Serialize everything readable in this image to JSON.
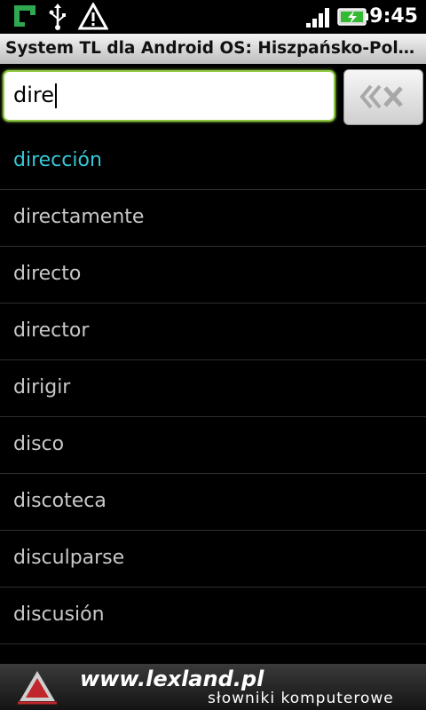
{
  "status_bar": {
    "time": "9:45",
    "icons": [
      "app-notification-icon",
      "usb-icon",
      "warning-icon",
      "signal-icon",
      "battery-charging-icon"
    ]
  },
  "title_bar": {
    "title": "System TL dla Android OS: Hiszpańsko-Polski..."
  },
  "search": {
    "value": "dire",
    "clear_icon": "backspace-clear-icon",
    "accent_color": "#8cc63e"
  },
  "results": {
    "selected_color": "#35c6d5",
    "items": [
      {
        "label": "dirección"
      },
      {
        "label": "directamente"
      },
      {
        "label": "directo"
      },
      {
        "label": "director"
      },
      {
        "label": "dirigir"
      },
      {
        "label": "disco"
      },
      {
        "label": "discoteca"
      },
      {
        "label": "disculparse"
      },
      {
        "label": "discusión"
      }
    ]
  },
  "banner": {
    "site": "www.lexland.pl",
    "tagline": "słowniki komputerowe",
    "logo_icon": "lexland-logo-icon"
  }
}
